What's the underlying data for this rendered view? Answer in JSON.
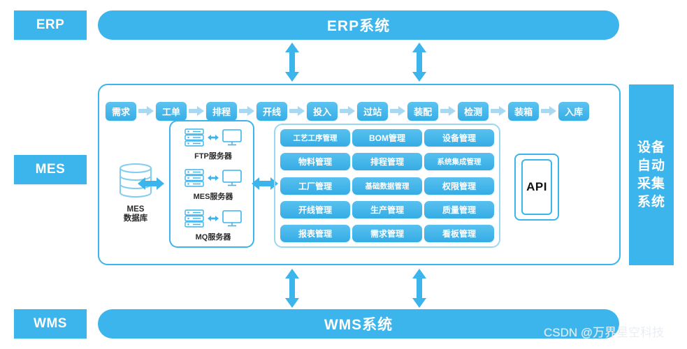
{
  "tiers": [
    {
      "id": "erp",
      "label": "ERP"
    },
    {
      "id": "mes",
      "label": "MES"
    },
    {
      "id": "wms",
      "label": "WMS"
    }
  ],
  "bars": {
    "erp_system": "ERP系统",
    "wms_system": "WMS系统"
  },
  "flow": {
    "nodes": [
      "需求",
      "工单",
      "排程",
      "开线",
      "投入",
      "过站",
      "装配",
      "检测",
      "装箱",
      "入库"
    ]
  },
  "database": {
    "icon": "database-icon",
    "line1": "MES",
    "line2": "数据库"
  },
  "servers": [
    {
      "label": "FTP服务器",
      "icon": "server-rack-icon",
      "target": "monitor-icon"
    },
    {
      "label": "MES服务器",
      "icon": "server-rack-icon",
      "target": "monitor-icon"
    },
    {
      "label": "MQ服务器",
      "icon": "server-rack-icon",
      "target": "monitor-icon"
    }
  ],
  "modules": {
    "rows": [
      [
        "工艺工序管理",
        "BOM管理",
        "设备管理"
      ],
      [
        "物料管理",
        "排程管理",
        "系统集成管理"
      ],
      [
        "工厂管理",
        "基础数据管理",
        "权限管理"
      ],
      [
        "开线管理",
        "生产管理",
        "质量管理"
      ],
      [
        "报表管理",
        "需求管理",
        "看板管理"
      ]
    ]
  },
  "api": {
    "label": "API"
  },
  "right_bar": {
    "lines": [
      "设备",
      "自动",
      "采集",
      "系统"
    ]
  },
  "watermark": {
    "text": "CSDN @万界星空科技"
  },
  "colors": {
    "primary": "#3cb4ec",
    "chip_light": "#58c1ef",
    "chip_dark": "#35ace5",
    "panel_border_light": "#9ad8f2",
    "text_dark": "#2b2b2b",
    "white": "#ffffff"
  }
}
